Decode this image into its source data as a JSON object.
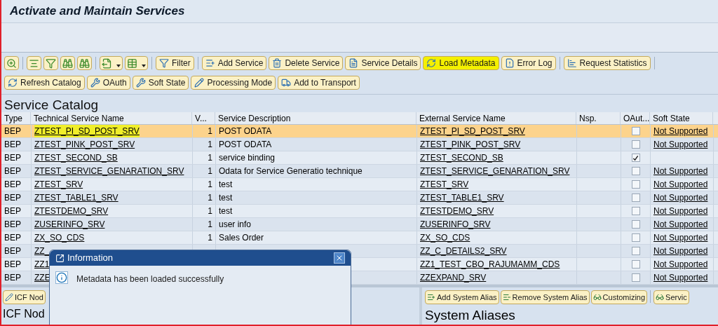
{
  "window": {
    "title": "Activate and Maintain Services"
  },
  "toolbar_1": {
    "icon_buttons": [
      {
        "has_menu": false
      },
      {
        "has_menu": false
      },
      {
        "has_menu": false
      },
      {
        "has_menu": false
      },
      {
        "has_menu": false
      },
      {
        "has_menu": true
      },
      {
        "has_menu": true
      }
    ],
    "buttons": [
      {
        "label": "Filter",
        "highlighted": false
      },
      {
        "label": "Add Service",
        "highlighted": false
      },
      {
        "label": "Delete Service",
        "highlighted": false
      },
      {
        "label": "Service Details",
        "highlighted": false
      },
      {
        "label": "Load Metadata",
        "highlighted": true
      },
      {
        "label": "Error Log",
        "highlighted": false
      },
      {
        "label": "Request Statistics",
        "highlighted": false
      }
    ]
  },
  "toolbar_2": {
    "buttons": [
      {
        "label": "Refresh Catalog"
      },
      {
        "label": "OAuth"
      },
      {
        "label": "Soft State"
      },
      {
        "label": "Processing Mode"
      },
      {
        "label": "Add to Transport"
      }
    ]
  },
  "catalog": {
    "heading": "Service Catalog",
    "columns": [
      "Type",
      "Technical Service Name",
      "V...",
      "Service Description",
      "External Service Name",
      "Nsp.",
      "OAut...",
      "Soft State"
    ],
    "rows": [
      {
        "type": "BEP",
        "technical_name": "ZTEST_PI_SD_POST_SRV",
        "version": "1",
        "description": "POST ODATA",
        "external_name": "ZTEST_PI_SD_POST_SRV",
        "oauth": false,
        "soft_state": "Not Supported",
        "selected": true
      },
      {
        "type": "BEP",
        "technical_name": "ZTEST_PINK_POST_SRV",
        "version": "1",
        "description": "POST ODATA",
        "external_name": "ZTEST_PINK_POST_SRV",
        "oauth": false,
        "soft_state": "Not Supported",
        "selected": false
      },
      {
        "type": "BEP",
        "technical_name": "ZTEST_SECOND_SB",
        "version": "1",
        "description": "service binding",
        "external_name": "ZTEST_SECOND_SB",
        "oauth": true,
        "selected": false
      },
      {
        "type": "BEP",
        "technical_name": "ZTEST_SERVICE_GENARATION_SRV",
        "version": "1",
        "description": "Odata for Service Generatio technique",
        "external_name": "ZTEST_SERVICE_GENARATION_SRV",
        "oauth": false,
        "soft_state": "Not Supported",
        "selected": false
      },
      {
        "type": "BEP",
        "technical_name": "ZTEST_SRV",
        "version": "1",
        "description": "test",
        "external_name": "ZTEST_SRV",
        "oauth": false,
        "soft_state": "Not Supported",
        "selected": false
      },
      {
        "type": "BEP",
        "technical_name": "ZTEST_TABLE1_SRV",
        "version": "1",
        "description": "test",
        "external_name": "ZTEST_TABLE1_SRV",
        "oauth": false,
        "soft_state": "Not Supported",
        "selected": false
      },
      {
        "type": "BEP",
        "technical_name": "ZTESTDEMO_SRV",
        "version": "1",
        "description": "test",
        "external_name": "ZTESTDEMO_SRV",
        "oauth": false,
        "soft_state": "Not Supported",
        "selected": false
      },
      {
        "type": "BEP",
        "technical_name": "ZUSERINFO_SRV",
        "version": "1",
        "description": "user info",
        "external_name": "ZUSERINFO_SRV",
        "oauth": false,
        "soft_state": "Not Supported",
        "selected": false
      },
      {
        "type": "BEP",
        "technical_name": "ZX_SO_CDS",
        "version": "1",
        "description": "Sales Order",
        "external_name": "ZX_SO_CDS",
        "oauth": false,
        "soft_state": "Not Supported",
        "selected": false
      },
      {
        "type": "BEP",
        "technical_name": "ZZ_",
        "external_name": "ZZ_C_DETAILS2_SRV",
        "oauth": false,
        "soft_state": "Not Supported",
        "selected": false
      },
      {
        "type": "BEP",
        "technical_name": "ZZ1",
        "external_name": "ZZ1_TEST_CBO_RAJUMAMM_CDS",
        "oauth": false,
        "soft_state": "Not Supported",
        "selected": false
      },
      {
        "type": "BEP",
        "technical_name": "ZZE",
        "external_name": "ZZEXPAND_SRV",
        "oauth": false,
        "soft_state": "Not Supported",
        "selected": false
      }
    ]
  },
  "icf_pane": {
    "button": "ICF Nod",
    "heading": "ICF Nod"
  },
  "alias_pane": {
    "buttons": [
      "Add System Alias",
      "Remove System Alias",
      "Customizing",
      "Servic"
    ],
    "heading": "System Aliases"
  },
  "dialog": {
    "title": "Information",
    "message": "Metadata has been loaded successfully"
  }
}
